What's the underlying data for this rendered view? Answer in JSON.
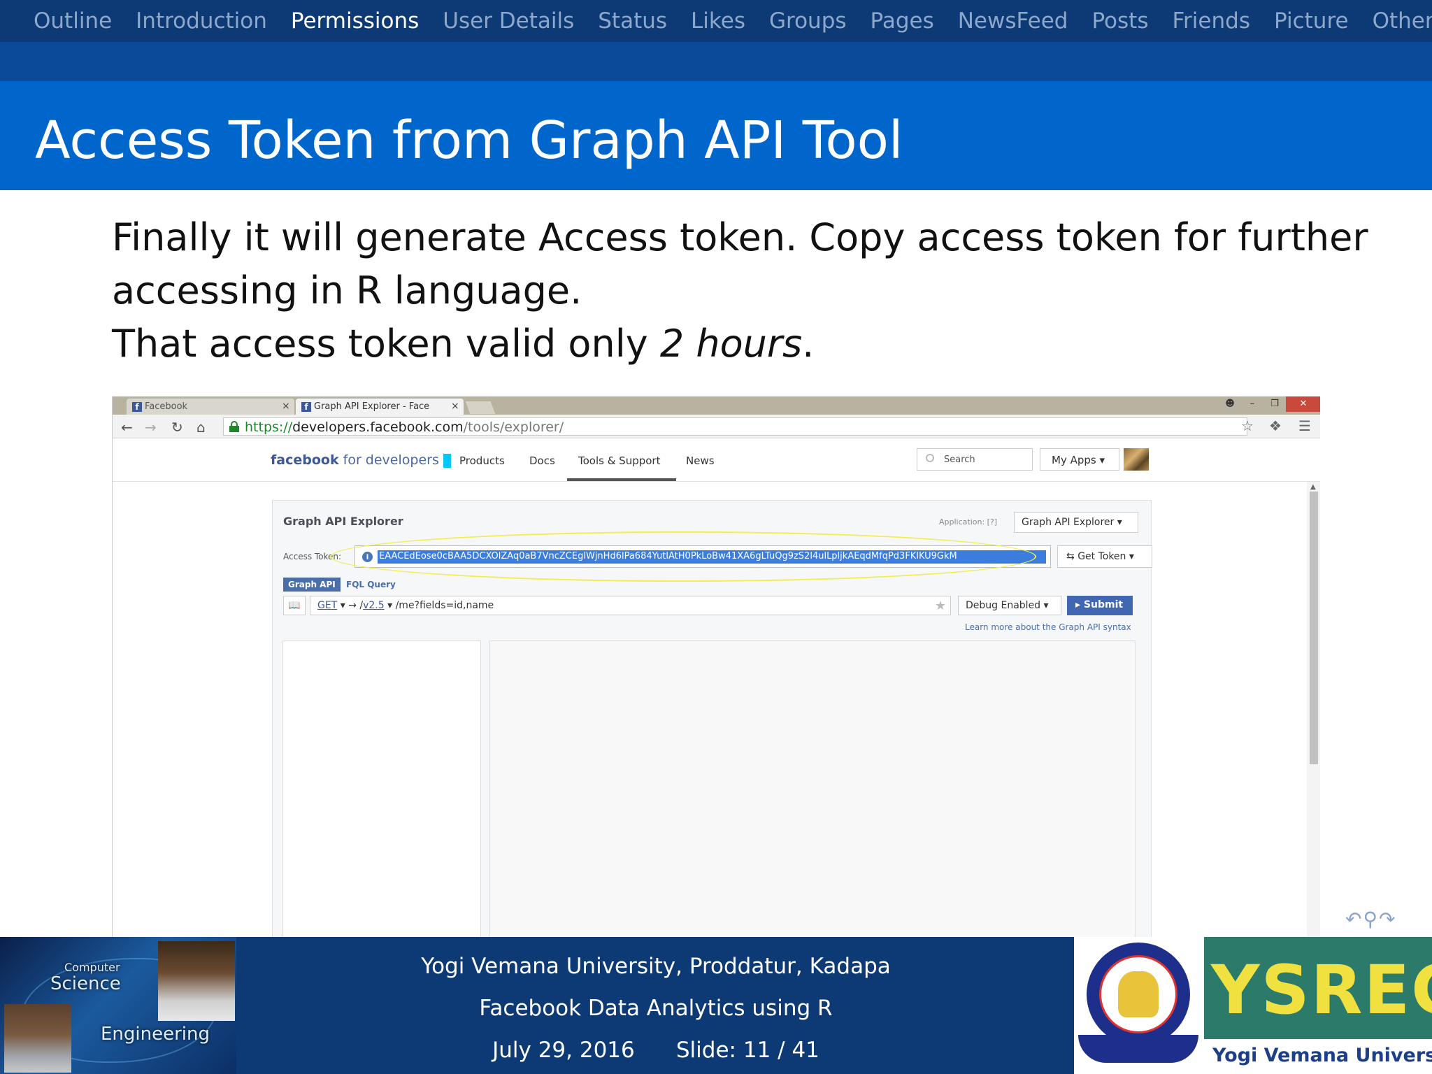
{
  "nav": {
    "items": [
      "Outline",
      "Introduction",
      "Permissions",
      "User Details",
      "Status",
      "Likes",
      "Groups",
      "Pages",
      "NewsFeed",
      "Posts",
      "Friends",
      "Picture",
      "Others"
    ],
    "active": "Permissions"
  },
  "slide": {
    "title": "Access Token from Graph API Tool",
    "line1": "Finally it will generate Access token. Copy access token for further",
    "line2": "accessing in R language.",
    "line3_prefix": "That access token valid only ",
    "line3_emph": "2 hours",
    "line3_suffix": "."
  },
  "browser": {
    "tabs": [
      {
        "label": "Facebook",
        "close": "×"
      },
      {
        "label": "Graph API Explorer - Face",
        "close": "×"
      }
    ],
    "url_scheme": "https://",
    "url_host": "developers.facebook.com",
    "url_path": "/tools/explorer/"
  },
  "fb": {
    "logo_brand": "facebook",
    "logo_suffix": "for developers",
    "nav": [
      "Products",
      "Docs",
      "Tools & Support",
      "News"
    ],
    "search_placeholder": "Search",
    "my_apps": "My Apps"
  },
  "explorer": {
    "title": "Graph API Explorer",
    "application_label": "Application:",
    "help": "[?]",
    "application_value": "Graph API Explorer",
    "access_token_label": "Access Token:",
    "access_token_value": "EAACEdEose0cBAA5DCXOlZAq0aB7VncZCEglWjnHd6lPa684YutlAtH0PkLoBw41XA6gLTuQg9zS2l4ulLpljkAEqdMfqPd3FKlKU9GkM",
    "get_token": "Get Token",
    "tab_graph": "Graph API",
    "tab_fql": "FQL Query",
    "method": "GET",
    "arrow": "→ /",
    "version": "v2.5",
    "path": "/me?fields=id,name",
    "debug": "Debug Enabled",
    "submit": "Submit",
    "learn_more": "Learn more about the Graph API syntax"
  },
  "footer": {
    "university": "Yogi Vemana University, Proddatur, Kadapa",
    "course": "Facebook Data Analytics using R",
    "date": "July 29, 2016",
    "slide_label": "Slide:",
    "slide_no": "11 / 41",
    "logo_computer": "Computer",
    "logo_science": "Science",
    "logo_engineering": "Engineering",
    "ysrec": "YSREC",
    "ysrec_sub": "Yogi Vemana University"
  },
  "colors": {
    "nav_bg": "#0d3a75",
    "title_bg": "#0066cc",
    "token_highlight": "#3b7ddd",
    "annotation": "#f0ee50"
  }
}
